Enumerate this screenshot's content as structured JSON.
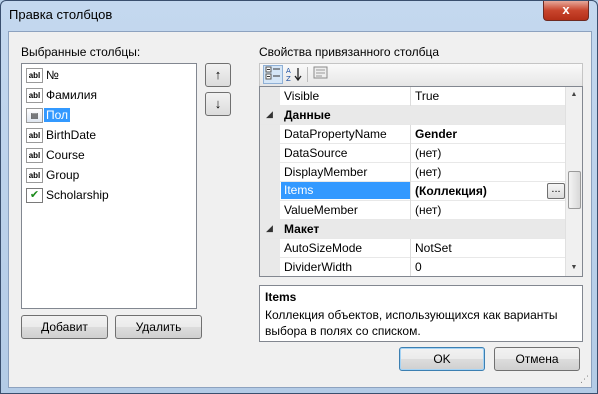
{
  "window": {
    "title": "Правка столбцов",
    "close_glyph": "x"
  },
  "left": {
    "label": "Выбранные столбцы:",
    "columns": [
      {
        "icon": "text-box-icon",
        "icon_text": "abl",
        "label": "№"
      },
      {
        "icon": "text-box-icon",
        "icon_text": "abl",
        "label": "Фамилия"
      },
      {
        "icon": "combo-box-icon",
        "icon_text": "▤",
        "label": "Пол",
        "selected": true
      },
      {
        "icon": "text-box-icon",
        "icon_text": "abl",
        "label": "BirthDate"
      },
      {
        "icon": "text-box-icon",
        "icon_text": "abl",
        "label": "Course"
      },
      {
        "icon": "text-box-icon",
        "icon_text": "abl",
        "label": "Group"
      },
      {
        "icon": "checkbox-icon",
        "icon_text": "✔",
        "label": "Scholarship"
      }
    ],
    "move_up": "↑",
    "move_down": "↓",
    "add_button": "Добавит",
    "remove_button": "Удалить"
  },
  "right": {
    "label": "Свойства привязанного столбца",
    "toolbar": {
      "categorized_icon": "categorized-icon",
      "alphabetical_icon": "alphabetical-sort-icon",
      "property_pages_icon": "property-pages-icon"
    },
    "properties": [
      {
        "type": "prop",
        "name": "Visible",
        "value": "True"
      },
      {
        "type": "cat",
        "name": "Данные"
      },
      {
        "type": "prop",
        "name": "DataPropertyName",
        "value": "Gender",
        "bold": true
      },
      {
        "type": "prop",
        "name": "DataSource",
        "value": "(нет)"
      },
      {
        "type": "prop",
        "name": "DisplayMember",
        "value": "(нет)"
      },
      {
        "type": "prop",
        "name": "Items",
        "value": "(Коллекция)",
        "bold": true,
        "selected": true,
        "ellipsis": "..."
      },
      {
        "type": "prop",
        "name": "ValueMember",
        "value": "(нет)"
      },
      {
        "type": "cat",
        "name": "Макет"
      },
      {
        "type": "prop",
        "name": "AutoSizeMode",
        "value": "NotSet"
      },
      {
        "type": "prop",
        "name": "DividerWidth",
        "value": "0"
      }
    ],
    "help": {
      "title": "Items",
      "description": "Коллекция объектов, использующихся как варианты выбора в полях со списком."
    }
  },
  "footer": {
    "ok": "OK",
    "cancel": "Отмена"
  }
}
